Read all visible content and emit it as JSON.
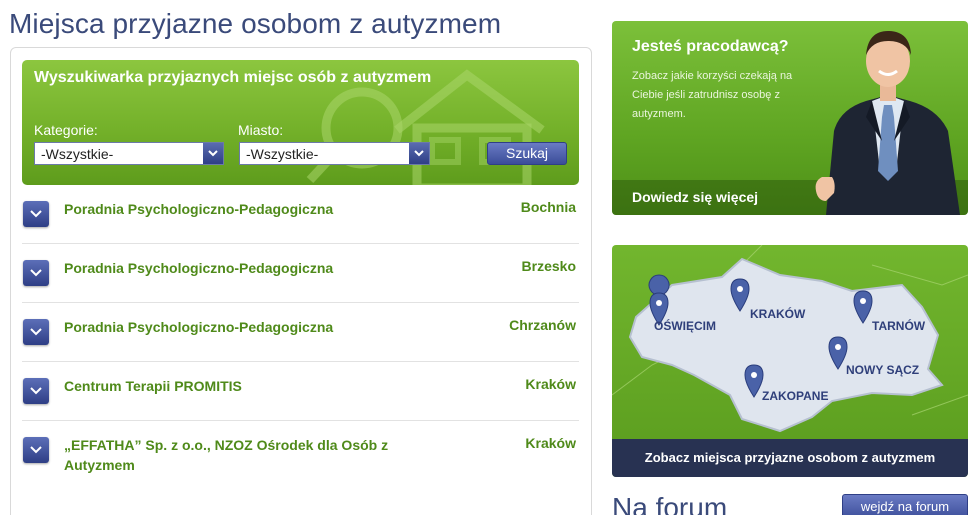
{
  "page_title": "Miejsca przyjazne osobom z autyzmem",
  "search": {
    "title": "Wyszukiwarka przyjaznych miejsc osób z autyzmem",
    "category_label": "Kategorie:",
    "category_value": "-Wszystkie-",
    "city_label": "Miasto:",
    "city_value": "-Wszystkie-",
    "button_label": "Szukaj"
  },
  "results": [
    {
      "name": "Poradnia Psychologiczno-Pedagogiczna",
      "city": "Bochnia"
    },
    {
      "name": "Poradnia Psychologiczno-Pedagogiczna",
      "city": "Brzesko"
    },
    {
      "name": "Poradnia Psychologiczno-Pedagogiczna",
      "city": "Chrzanów"
    },
    {
      "name": "Centrum Terapii PROMITIS",
      "city": "Kraków"
    },
    {
      "name": "„EFFATHA” Sp. z o.o., NZOZ Ośrodek dla Osób z Autyzmem",
      "city": "Kraków"
    }
  ],
  "employer": {
    "title": "Jesteś pracodawcą?",
    "text": "Zobacz jakie korzyści czekają na Ciebie jeśli zatrudnisz osobę z autyzmem.",
    "link": "Dowiedz się więcej"
  },
  "map": {
    "cities": [
      "OŚWIĘCIM",
      "KRAKÓW",
      "TARNÓW",
      "NOWY SĄCZ",
      "ZAKOPANE"
    ],
    "link": "Zobacz miejsca przyjazne osobom z autyzmem"
  },
  "forum": {
    "title": "Na forum",
    "button": "wejdź na forum"
  },
  "colors": {
    "accent_green": "#74b12a",
    "link_green": "#4f8a1a",
    "navy": "#3a4a7a",
    "dark_bar": "#283252"
  }
}
